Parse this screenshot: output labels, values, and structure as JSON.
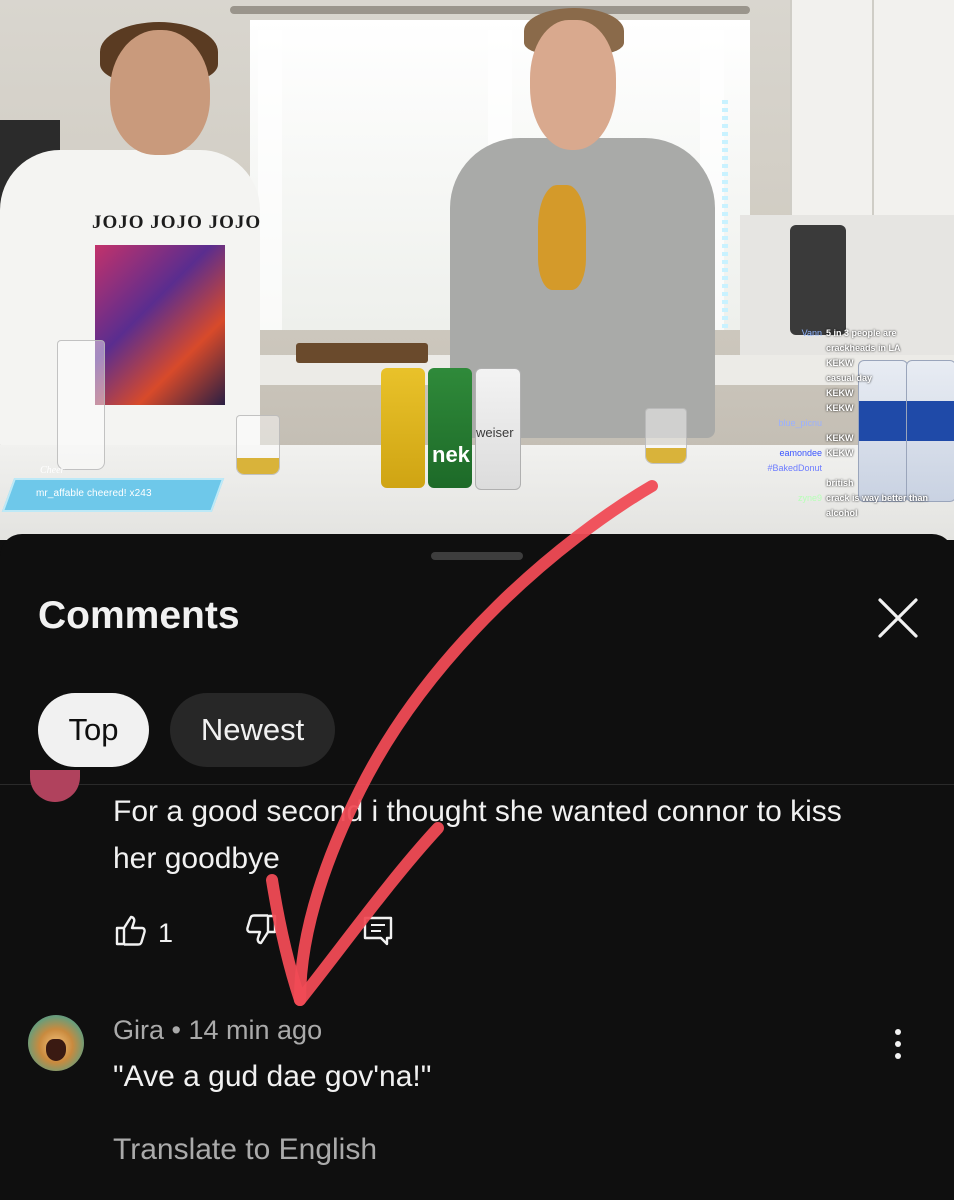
{
  "video": {
    "shirt_text": "JOJO JOJO JOJO",
    "cheer_tag": "Cheer",
    "cheer_text": "mr_affable cheered! x243",
    "chat": [
      {
        "user": "Vann",
        "color": "#8fb4ff",
        "msg": "5 in 3 people are"
      },
      {
        "user": "",
        "color": "#ffffff",
        "msg": "crackheads in LA"
      },
      {
        "user": "",
        "color": "#ff6a6a",
        "msg": "KEKW"
      },
      {
        "user": "",
        "color": "#c58cff",
        "msg": "casual day"
      },
      {
        "user": "",
        "color": "#ff6a6a",
        "msg": "KEKW"
      },
      {
        "user": "",
        "color": "#8f7bff",
        "msg": "KEKW"
      },
      {
        "user": "blue_picnu",
        "color": "#9ab0ff",
        "msg": ""
      },
      {
        "user": "",
        "color": "#b5a0ff",
        "msg": "KEKW"
      },
      {
        "user": "eamondee",
        "color": "#3a55ff",
        "msg": "KEKW"
      },
      {
        "user": "#BakedDonut",
        "color": "#6d7cff",
        "msg": ""
      },
      {
        "user": "",
        "color": "#c7a6ff",
        "msg": "british"
      },
      {
        "user": "zyne9",
        "color": "#b7ffb7",
        "msg": "crack is way better than"
      },
      {
        "user": "",
        "color": "#ffffff",
        "msg": "alcohol"
      }
    ],
    "can_labels": [
      "weiser",
      "nek"
    ]
  },
  "comments": {
    "title": "Comments",
    "close_label": "close",
    "chips": [
      "Top",
      "Newest"
    ],
    "active_chip": "Top",
    "first_comment": {
      "text": "For a good second i thought she wanted connor to kiss her goodbye",
      "likes": "1"
    },
    "second_comment": {
      "author": "Gira",
      "time": "14 min ago",
      "separator": "•",
      "text": "\"Ave a gud dae gov'na!\"",
      "translate_label": "Translate to English"
    }
  },
  "colors": {
    "background": "#0f0f0f",
    "text_primary": "#f1f1f1",
    "text_secondary": "#aaaaaa",
    "chip_active": "#f1f1f1",
    "chip_inactive": "#272727",
    "annotation_arrow": "#f04b55"
  }
}
